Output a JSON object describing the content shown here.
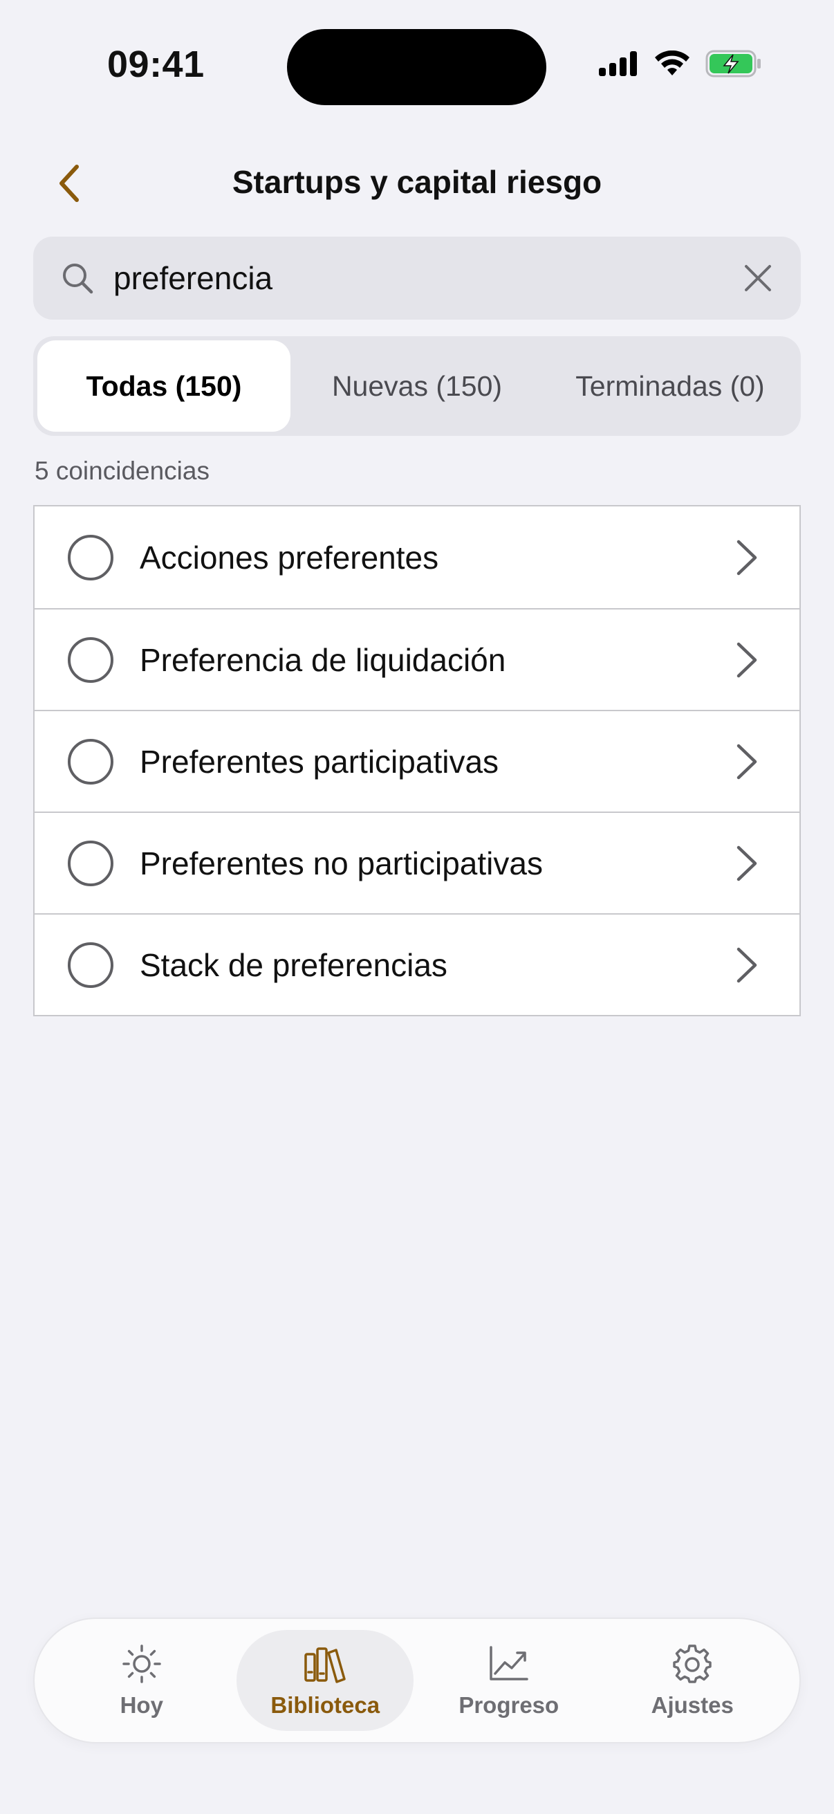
{
  "status_bar": {
    "time": "09:41"
  },
  "header": {
    "title": "Startups y capital riesgo"
  },
  "search": {
    "value": "preferencia",
    "placeholder": ""
  },
  "segments": [
    {
      "label": "Todas (150)",
      "active": true
    },
    {
      "label": "Nuevas (150)",
      "active": false
    },
    {
      "label": "Terminadas (0)",
      "active": false
    }
  ],
  "results": {
    "count_label": "5 coincidencias",
    "items": [
      {
        "label": "Acciones preferentes"
      },
      {
        "label": "Preferencia de liquidación"
      },
      {
        "label": "Preferentes participativas"
      },
      {
        "label": "Preferentes no participativas"
      },
      {
        "label": "Stack de preferencias"
      }
    ]
  },
  "tabbar": {
    "tabs": [
      {
        "label": "Hoy",
        "icon": "sun-icon",
        "active": false
      },
      {
        "label": "Biblioteca",
        "icon": "books-icon",
        "active": true
      },
      {
        "label": "Progreso",
        "icon": "chart-icon",
        "active": false
      },
      {
        "label": "Ajustes",
        "icon": "gear-icon",
        "active": false
      }
    ]
  },
  "colors": {
    "accent": "#8a5a0c",
    "background": "#f2f2f7",
    "battery": "#34c759"
  }
}
